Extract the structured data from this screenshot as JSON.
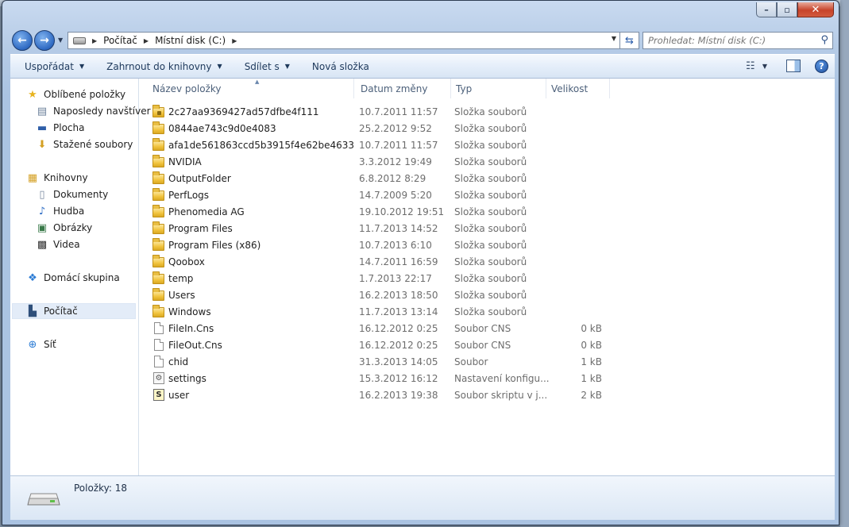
{
  "window": {
    "caption_buttons": [
      "minimize",
      "maximize",
      "close"
    ]
  },
  "address": {
    "crumbs": [
      "Počítač",
      "Místní disk (C:)"
    ],
    "search_placeholder": "Prohledat: Místní disk (C:)"
  },
  "toolbar": {
    "organize": "Uspořádat",
    "include_library": "Zahrnout do knihovny",
    "share": "Sdílet s",
    "new_folder": "Nová složka"
  },
  "nav": {
    "favorites": "Oblíbené položky",
    "recent": "Naposledy navštíver",
    "desktop": "Plocha",
    "downloads": "Stažené soubory",
    "libraries": "Knihovny",
    "documents": "Dokumenty",
    "music": "Hudba",
    "pictures": "Obrázky",
    "videos": "Videa",
    "homegroup": "Domácí skupina",
    "computer": "Počítač",
    "network": "Síť"
  },
  "columns": {
    "name": "Název položky",
    "date": "Datum změny",
    "type": "Typ",
    "size": "Velikost"
  },
  "files": [
    {
      "name": "2c27aa9369427ad57dfbe4f111",
      "date": "10.7.2011 11:57",
      "type": "Složka souborů",
      "size": "",
      "icon": "folder-locked-icon"
    },
    {
      "name": "0844ae743c9d0e4083",
      "date": "25.2.2012 9:52",
      "type": "Složka souborů",
      "size": "",
      "icon": "folder-icon"
    },
    {
      "name": "afa1de561863ccd5b3915f4e62be4633",
      "date": "10.7.2011 11:57",
      "type": "Složka souborů",
      "size": "",
      "icon": "folder-icon"
    },
    {
      "name": "NVIDIA",
      "date": "3.3.2012 19:49",
      "type": "Složka souborů",
      "size": "",
      "icon": "folder-icon"
    },
    {
      "name": "OutputFolder",
      "date": "6.8.2012 8:29",
      "type": "Složka souborů",
      "size": "",
      "icon": "folder-icon"
    },
    {
      "name": "PerfLogs",
      "date": "14.7.2009 5:20",
      "type": "Složka souborů",
      "size": "",
      "icon": "folder-icon"
    },
    {
      "name": "Phenomedia AG",
      "date": "19.10.2012 19:51",
      "type": "Složka souborů",
      "size": "",
      "icon": "folder-icon"
    },
    {
      "name": "Program Files",
      "date": "11.7.2013 14:52",
      "type": "Složka souborů",
      "size": "",
      "icon": "folder-icon"
    },
    {
      "name": "Program Files (x86)",
      "date": "10.7.2013 6:10",
      "type": "Složka souborů",
      "size": "",
      "icon": "folder-icon"
    },
    {
      "name": "Qoobox",
      "date": "14.7.2011 16:59",
      "type": "Složka souborů",
      "size": "",
      "icon": "folder-icon"
    },
    {
      "name": "temp",
      "date": "1.7.2013 22:17",
      "type": "Složka souborů",
      "size": "",
      "icon": "folder-icon"
    },
    {
      "name": "Users",
      "date": "16.2.2013 18:50",
      "type": "Složka souborů",
      "size": "",
      "icon": "folder-icon"
    },
    {
      "name": "Windows",
      "date": "11.7.2013 13:14",
      "type": "Složka souborů",
      "size": "",
      "icon": "folder-icon"
    },
    {
      "name": "FileIn.Cns",
      "date": "16.12.2012 0:25",
      "type": "Soubor CNS",
      "size": "0 kB",
      "icon": "file-icon"
    },
    {
      "name": "FileOut.Cns",
      "date": "16.12.2012 0:25",
      "type": "Soubor CNS",
      "size": "0 kB",
      "icon": "file-icon"
    },
    {
      "name": "chid",
      "date": "31.3.2013 14:05",
      "type": "Soubor",
      "size": "1 kB",
      "icon": "file-icon"
    },
    {
      "name": "settings",
      "date": "15.3.2012 16:12",
      "type": "Nastavení konfigu...",
      "size": "1 kB",
      "icon": "settings-file-icon"
    },
    {
      "name": "user",
      "date": "16.2.2013 19:38",
      "type": "Soubor skriptu v j...",
      "size": "2 kB",
      "icon": "script-file-icon"
    }
  ],
  "status": {
    "items_count": "Položky: 18"
  }
}
